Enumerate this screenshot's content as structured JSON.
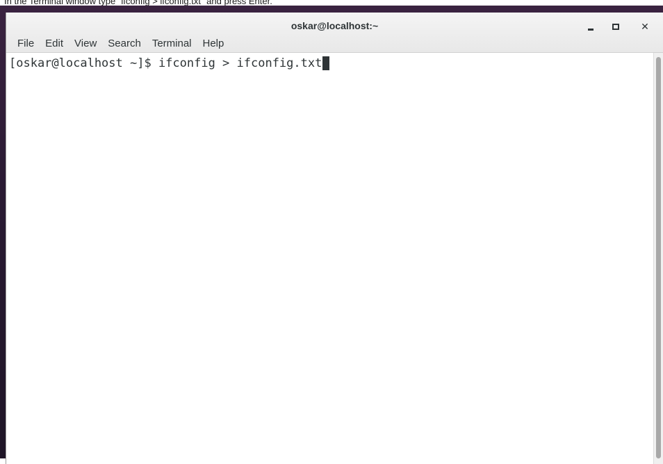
{
  "instruction": "In the Terminal window type \"ifconfig > ifconfig.txt\" and press Enter.",
  "window": {
    "title": "oskar@localhost:~",
    "minimize_label": "–",
    "close_label": "✕"
  },
  "menubar": {
    "items": [
      {
        "label": "File"
      },
      {
        "label": "Edit"
      },
      {
        "label": "View"
      },
      {
        "label": "Search"
      },
      {
        "label": "Terminal"
      },
      {
        "label": "Help"
      }
    ]
  },
  "terminal": {
    "prompt": "[oskar@localhost ~]$ ",
    "command": "ifconfig > ifconfig.txt"
  },
  "icons": {
    "minimize": "minimize-icon",
    "maximize": "maximize-icon",
    "close": "close-icon"
  },
  "colors": {
    "titlebar": "#ececec",
    "terminal_bg": "#ffffff",
    "terminal_fg": "#2e3436",
    "desktop": "#2a1a33"
  }
}
